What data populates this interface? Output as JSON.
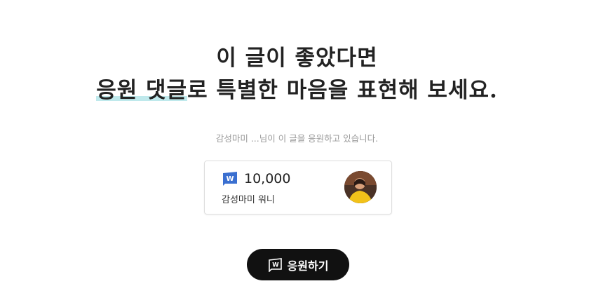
{
  "headline": {
    "line1": "이 글이 좋았다면",
    "line2_highlight": "응원 댓글",
    "line2_rest": "로 특별한 마음을 표현해 보세요."
  },
  "cheer_status": "감성마미 ...님이 이 글을 응원하고 있습니다.",
  "support_card": {
    "amount": "10,000",
    "supporter": "감성마미 워니",
    "coin_icon": "w-coin-icon"
  },
  "cheer_button": {
    "label": "응원하기",
    "icon": "w-coin-icon"
  },
  "colors": {
    "highlight": "#bfe9ec",
    "button_bg": "#111111",
    "coin_blue": "#3a6fd0"
  }
}
